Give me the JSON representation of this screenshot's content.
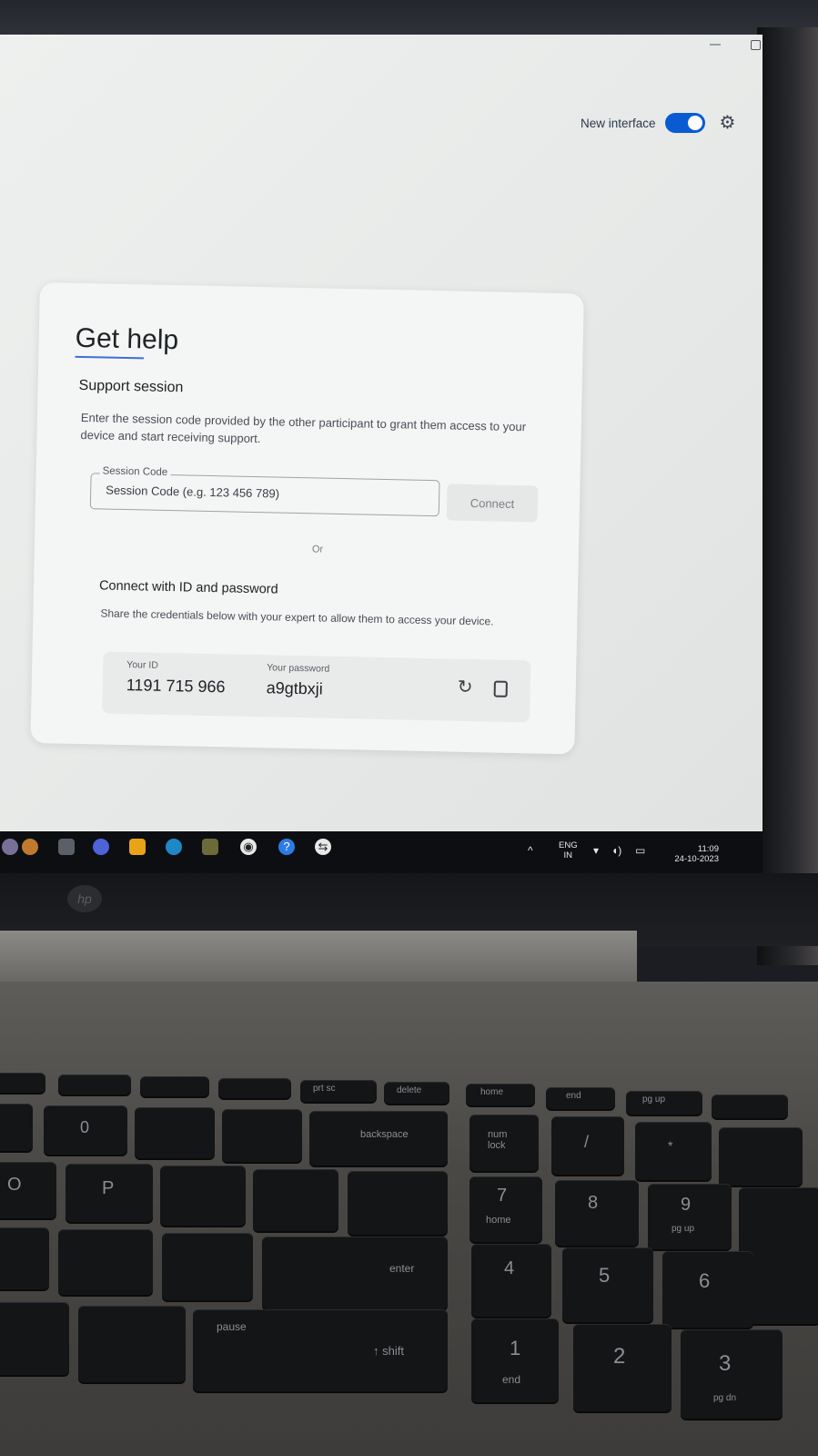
{
  "window": {
    "new_interface_label": "New interface",
    "toggle_on": true
  },
  "panel": {
    "title": "Get help",
    "support_session": {
      "heading": "Support session",
      "description": "Enter the session code provided by the other participant to grant them access to your device and start receiving support.",
      "field_label": "Session Code",
      "field_placeholder": "Session Code (e.g. 123 456 789)",
      "connect_label": "Connect"
    },
    "or_label": "Or",
    "id_password": {
      "heading": "Connect with ID and password",
      "description": "Share the credentials below with your expert to allow them to access your device.",
      "id_label": "Your ID",
      "id_value": "1191 715 966",
      "password_label": "Your password",
      "password_value": "a9gtbxji"
    }
  },
  "taskbar": {
    "lang": "ENG",
    "region": "IN",
    "time": "11:09",
    "date": "24-10-2023"
  },
  "keyboard": {
    "prt_sc": "prt sc",
    "delete": "delete",
    "home": "home",
    "end": "end",
    "pg_up": "pg up",
    "backspace": "backspace",
    "num_lock_1": "num",
    "num_lock_2": "lock",
    "enter": "enter",
    "shift": "↑ shift",
    "pause": "pause",
    "k7": "7",
    "k7_sub": "home",
    "k8": "8",
    "k9": "9",
    "k9_sub": "pg up",
    "k4": "4",
    "k5": "5",
    "k6": "6",
    "k1": "1",
    "k1_sub": "end",
    "k2": "2",
    "k3": "3",
    "k3_sub": "pg dn",
    "k_p": "P",
    "k_o": "O",
    "k_0": "0",
    "k_slash": "/",
    "k_star": "*"
  }
}
